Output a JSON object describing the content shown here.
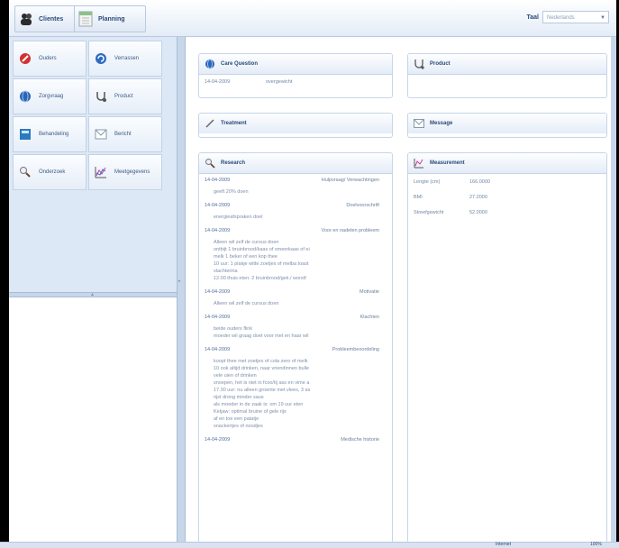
{
  "header": {
    "nav": [
      {
        "label": "Clientes",
        "icon": "people-icon"
      },
      {
        "label": "Planning",
        "icon": "calendar-icon"
      }
    ],
    "taal_label": "Taal",
    "taal_value": "Nederlands"
  },
  "sidebar": {
    "items": [
      {
        "label": "Ouders",
        "icon": "stop-icon"
      },
      {
        "label": "Verrassen",
        "icon": "refresh-icon"
      },
      {
        "label": "Zorgvraag",
        "icon": "globe-icon"
      },
      {
        "label": "Product",
        "icon": "stethoscope-icon"
      },
      {
        "label": "Behandeling",
        "icon": "calculator-icon"
      },
      {
        "label": "Bericht",
        "icon": "envelope-icon"
      },
      {
        "label": "Onderzoek",
        "icon": "magnifier-icon"
      },
      {
        "label": "Meetgegevens",
        "icon": "chart-icon"
      }
    ]
  },
  "panels": {
    "care_question": {
      "title": "Care Question",
      "row": {
        "date": "14-04-2009",
        "text": "overgewicht"
      }
    },
    "product": {
      "title": "Product"
    },
    "treatment": {
      "title": "Treatment"
    },
    "message": {
      "title": "Message"
    },
    "research": {
      "title": "Research",
      "entries": [
        {
          "date": "14-04-2009",
          "topic": "Hulpvraag/ Verwachtingen",
          "notes": [
            "geeft 20% doen"
          ]
        },
        {
          "date": "14-04-2009",
          "topic": "Doelvoorschrift",
          "notes": [
            "energieafspraken doel"
          ]
        },
        {
          "date": "14-04-2009",
          "topic": "Voor en nadelen probleem",
          "notes": [
            "Alleen wil zelf de cursus doen",
            "ontbijt 1 bruinbrood/kaas of smeerkaas of ei",
            "melk 1 beker of een kop thee",
            "10 uur: 1 plakje witte zoetjes of melba toast",
            "slachterina",
            "12.00 thuis eten: 2 bruinbrood/gek./ worstf"
          ]
        },
        {
          "date": "14-04-2009",
          "topic": "Motivatie",
          "notes": [
            "Alleen wil zelf de cursus doen"
          ]
        },
        {
          "date": "14-04-2009",
          "topic": "Klachten",
          "notes": [
            "beide ouders flink",
            "moeder wil graag doet voor met en haar wil"
          ]
        },
        {
          "date": "14-04-2009",
          "topic": "Probleembeoordeling",
          "notes": [
            "koopt thee met zoetjes of cola zero of melk",
            "10 ook altijd drinken, naar vriendinnen bulle",
            "vele uien of drinken",
            "snoepen, het is niet in fcoo/tij ass en vime a",
            "17.30 uur: nu alleen groente met vlees, 3 as",
            "rijst drong minder saus",
            "als moeder in de zaak is: om 19 uur eten",
            "Ketjaw: optimal bruine of gele rijs",
            "af en toe een patatje",
            "snackertjes of noodjes"
          ]
        },
        {
          "date": "14-04-2009",
          "topic": "Medische historie",
          "notes": []
        }
      ]
    },
    "measurement": {
      "title": "Measurement",
      "rows": [
        {
          "label": "Lengte (cm)",
          "value": "166.0000"
        },
        {
          "label": "BMI",
          "value": "27.2000"
        },
        {
          "label": "Streefgewicht",
          "value": "52.0000"
        }
      ]
    }
  },
  "statusbar": {
    "internet": "Internet",
    "zoom": "100%"
  }
}
